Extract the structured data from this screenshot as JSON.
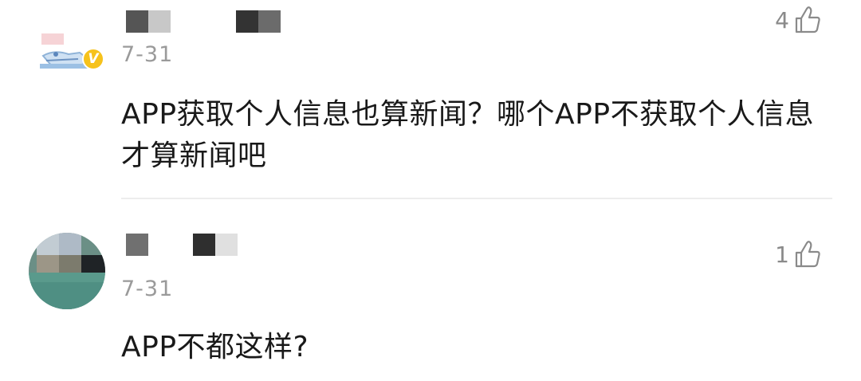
{
  "comments": [
    {
      "time": "7-31",
      "text": "APP获取个人信息也算新闻？哪个APP不获取个人信息才算新闻吧",
      "likes": "4",
      "verified_badge": "V",
      "username_redacted": true
    },
    {
      "time": "7-31",
      "text": "APP不都这样?",
      "likes": "1",
      "username_redacted": true
    }
  ],
  "colors": {
    "badge": "#f6c21c",
    "time": "#9a9a9a",
    "text": "#191919",
    "like": "#8a8a8a"
  },
  "icons": [
    "thumbs-up-icon",
    "verified-v-icon"
  ]
}
